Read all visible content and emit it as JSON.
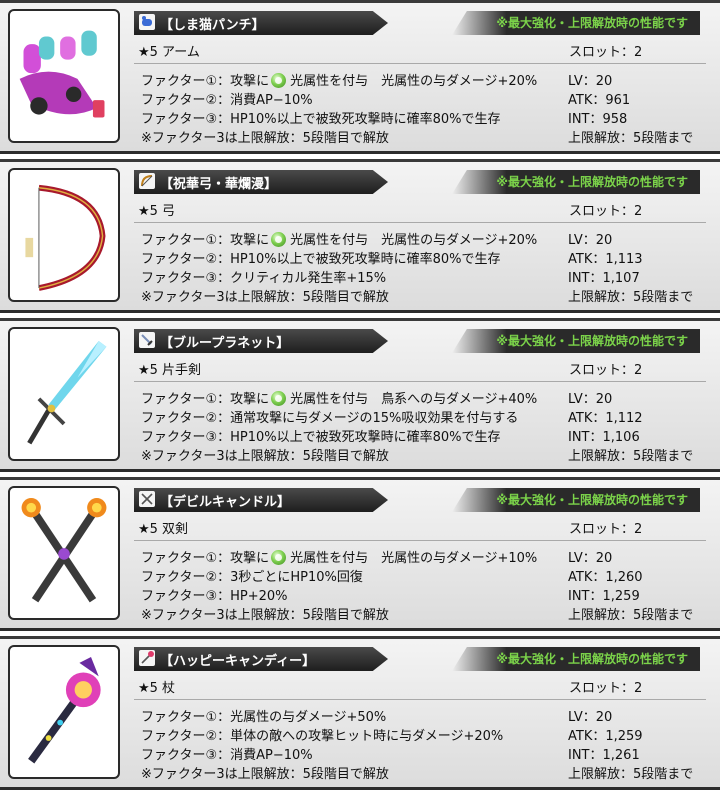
{
  "notice": "※最大強化・上限解放時の性能です",
  "colors": {
    "notice_text": "#7bd34a",
    "title_bar": "#2a2a2a",
    "light_icon": "#6cc43e"
  },
  "weapons": [
    {
      "icon": "arm-icon",
      "name": "【しま猫パンチ】",
      "rarity": "★5 アーム",
      "slot": "スロット：2",
      "factors": [
        {
          "prefix": "ファクター①：攻撃に",
          "light_icon": true,
          "text": "光属性を付与　光属性の与ダメージ+20%"
        },
        {
          "prefix": "",
          "light_icon": false,
          "text": "ファクター②：消費AP−10%"
        },
        {
          "prefix": "",
          "light_icon": false,
          "text": "ファクター③：HP10%以上で被致死攻撃時に確率80%で生存"
        },
        {
          "prefix": "",
          "light_icon": false,
          "text": "※ファクター3は上限解放：5段階目で解放"
        }
      ],
      "stats": [
        "LV：20",
        "ATK：961",
        "INT：958",
        "上限解放：5段階まで"
      ]
    },
    {
      "icon": "bow-icon",
      "name": "【祝華弓・華爛漫】",
      "rarity": "★5 弓",
      "slot": "スロット：2",
      "factors": [
        {
          "prefix": "ファクター①：攻撃に",
          "light_icon": true,
          "text": "光属性を付与　光属性の与ダメージ+20%"
        },
        {
          "prefix": "",
          "light_icon": false,
          "text": "ファクター②：HP10%以上で被致死攻撃時に確率80%で生存"
        },
        {
          "prefix": "",
          "light_icon": false,
          "text": "ファクター③：クリティカル発生率+15%"
        },
        {
          "prefix": "",
          "light_icon": false,
          "text": "※ファクター3は上限解放：5段階目で解放"
        }
      ],
      "stats": [
        "LV：20",
        "ATK：1,113",
        "INT：1,107",
        "上限解放：5段階まで"
      ]
    },
    {
      "icon": "sword-icon",
      "name": "【ブループラネット】",
      "rarity": "★5 片手剣",
      "slot": "スロット：2",
      "factors": [
        {
          "prefix": "ファクター①：攻撃に",
          "light_icon": true,
          "text": "光属性を付与　鳥系への与ダメージ+40%"
        },
        {
          "prefix": "",
          "light_icon": false,
          "text": "ファクター②：通常攻撃に与ダメージの15%吸収効果を付与する"
        },
        {
          "prefix": "",
          "light_icon": false,
          "text": "ファクター③：HP10%以上で被致死攻撃時に確率80%で生存"
        },
        {
          "prefix": "",
          "light_icon": false,
          "text": "※ファクター3は上限解放：5段階目で解放"
        }
      ],
      "stats": [
        "LV：20",
        "ATK：1,112",
        "INT：1,106",
        "上限解放：5段階まで"
      ]
    },
    {
      "icon": "dual-swords-icon",
      "name": "【デビルキャンドル】",
      "rarity": "★5 双剣",
      "slot": "スロット：2",
      "factors": [
        {
          "prefix": "ファクター①：攻撃に",
          "light_icon": true,
          "text": "光属性を付与　光属性の与ダメージ+10%"
        },
        {
          "prefix": "",
          "light_icon": false,
          "text": "ファクター②：3秒ごとにHP10%回復"
        },
        {
          "prefix": "",
          "light_icon": false,
          "text": "ファクター③：HP+20%"
        },
        {
          "prefix": "",
          "light_icon": false,
          "text": "※ファクター3は上限解放：5段階目で解放"
        }
      ],
      "stats": [
        "LV：20",
        "ATK：1,260",
        "INT：1,259",
        "上限解放：5段階まで"
      ]
    },
    {
      "icon": "staff-icon",
      "name": "【ハッピーキャンディー】",
      "rarity": "★5 杖",
      "slot": "スロット：2",
      "factors": [
        {
          "prefix": "",
          "light_icon": false,
          "text": "ファクター①：光属性の与ダメージ+50%"
        },
        {
          "prefix": "",
          "light_icon": false,
          "text": "ファクター②：単体の敵への攻撃ヒット時に与ダメージ+20%"
        },
        {
          "prefix": "",
          "light_icon": false,
          "text": "ファクター③：消費AP−10%"
        },
        {
          "prefix": "",
          "light_icon": false,
          "text": "※ファクター3は上限解放：5段階目で解放"
        }
      ],
      "stats": [
        "LV：20",
        "ATK：1,259",
        "INT：1,261",
        "上限解放：5段階まで"
      ]
    }
  ]
}
